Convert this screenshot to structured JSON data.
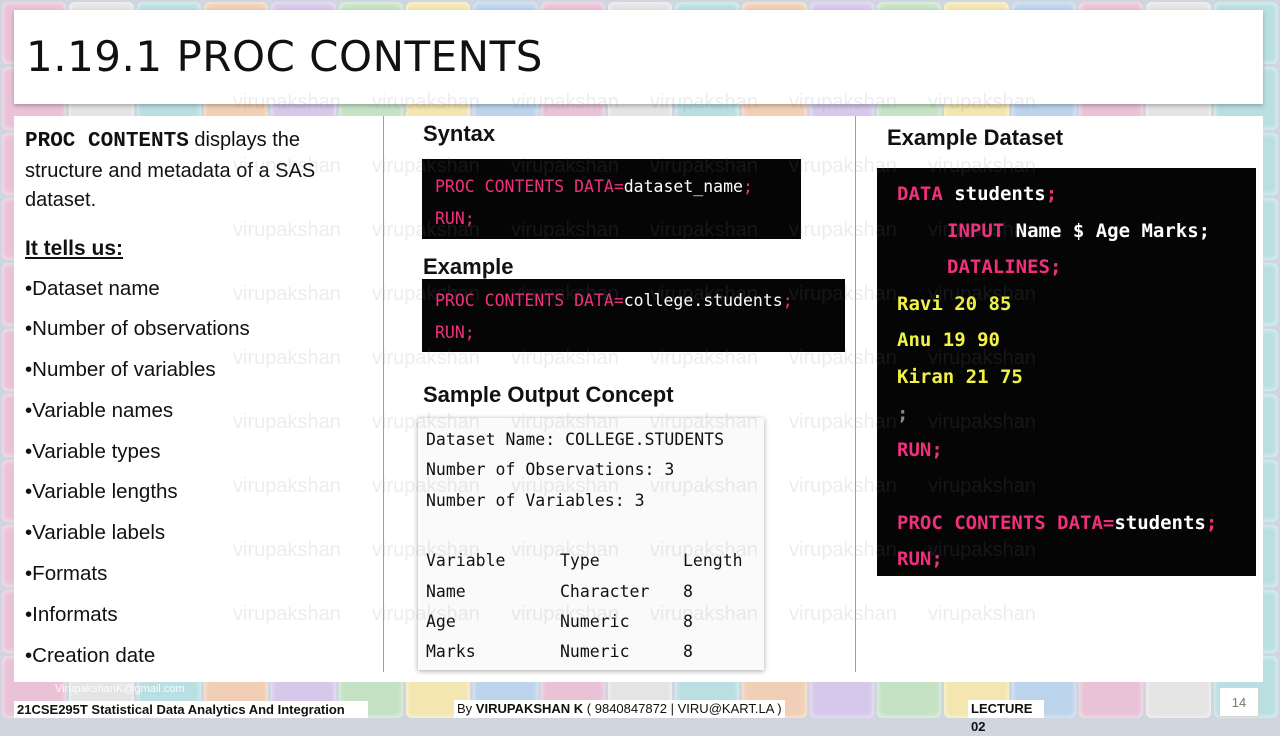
{
  "slide": {
    "title": "1.19.1 PROC CONTENTS",
    "intro_keyword": "PROC CONTENTS",
    "intro_text": " displays the structure and metadata of a SAS dataset.",
    "tells_heading": "It tells us:",
    "bullets": [
      "•Dataset name",
      "•Number of observations",
      "•Number of variables",
      "•Variable names",
      "•Variable types",
      "•Variable lengths",
      "•Variable labels",
      "•Formats",
      "•Informats",
      "•Creation date"
    ]
  },
  "syntax": {
    "heading": "Syntax",
    "l1_kw": "PROC CONTENTS DATA",
    "l1_eq": "=",
    "l1_val": "dataset_name",
    "l1_semi": ";",
    "l2": "RUN;"
  },
  "example": {
    "heading": "Example",
    "l1_kw": "PROC CONTENTS DATA",
    "l1_eq": "=",
    "l1_val": "college.students",
    "l1_semi": ";",
    "l2": "RUN;"
  },
  "sample_output": {
    "heading": "Sample Output Concept",
    "lines": [
      "Dataset Name: COLLEGE.STUDENTS",
      "Number of Observations: 3",
      "Number of Variables: 3"
    ],
    "table_header": [
      "Variable",
      "Type",
      "Length"
    ],
    "rows": [
      [
        "Name",
        "Character",
        "8"
      ],
      [
        "Age",
        "Numeric",
        "8"
      ],
      [
        "Marks",
        "Numeric",
        "8"
      ]
    ]
  },
  "example_dataset": {
    "heading": "Example Dataset",
    "data_kw": "DATA",
    "data_name": " students",
    "semi": ";",
    "input_kw": "INPUT",
    "input_vars": " Name $ Age Marks",
    "datalines_kw": "DATALINES",
    "rows": [
      "Ravi 20 85",
      "Anu 19 90",
      "Kiran 21 75"
    ],
    "terminator": ";",
    "run": "RUN;",
    "proc_kw": "PROC CONTENTS DATA",
    "proc_eq": "=",
    "proc_val": "students",
    "run2": "RUN;"
  },
  "footer": {
    "course": "21CSE295T Statistical Data Analytics And Integration",
    "by_label": "By ",
    "author": "VIRUPAKSHAN K",
    "contact": " ( 9840847872 | VIRU@KART.LA )",
    "lecture": "LECTURE 02",
    "page": "14",
    "email": "VirupakshanK@gmail.com"
  },
  "watermark_text": "virupakshan",
  "colors": {
    "keyword": "#f0307a",
    "data_rows": "#f2f244",
    "code_bg": "#050505",
    "divider": "#8ea4bd"
  }
}
